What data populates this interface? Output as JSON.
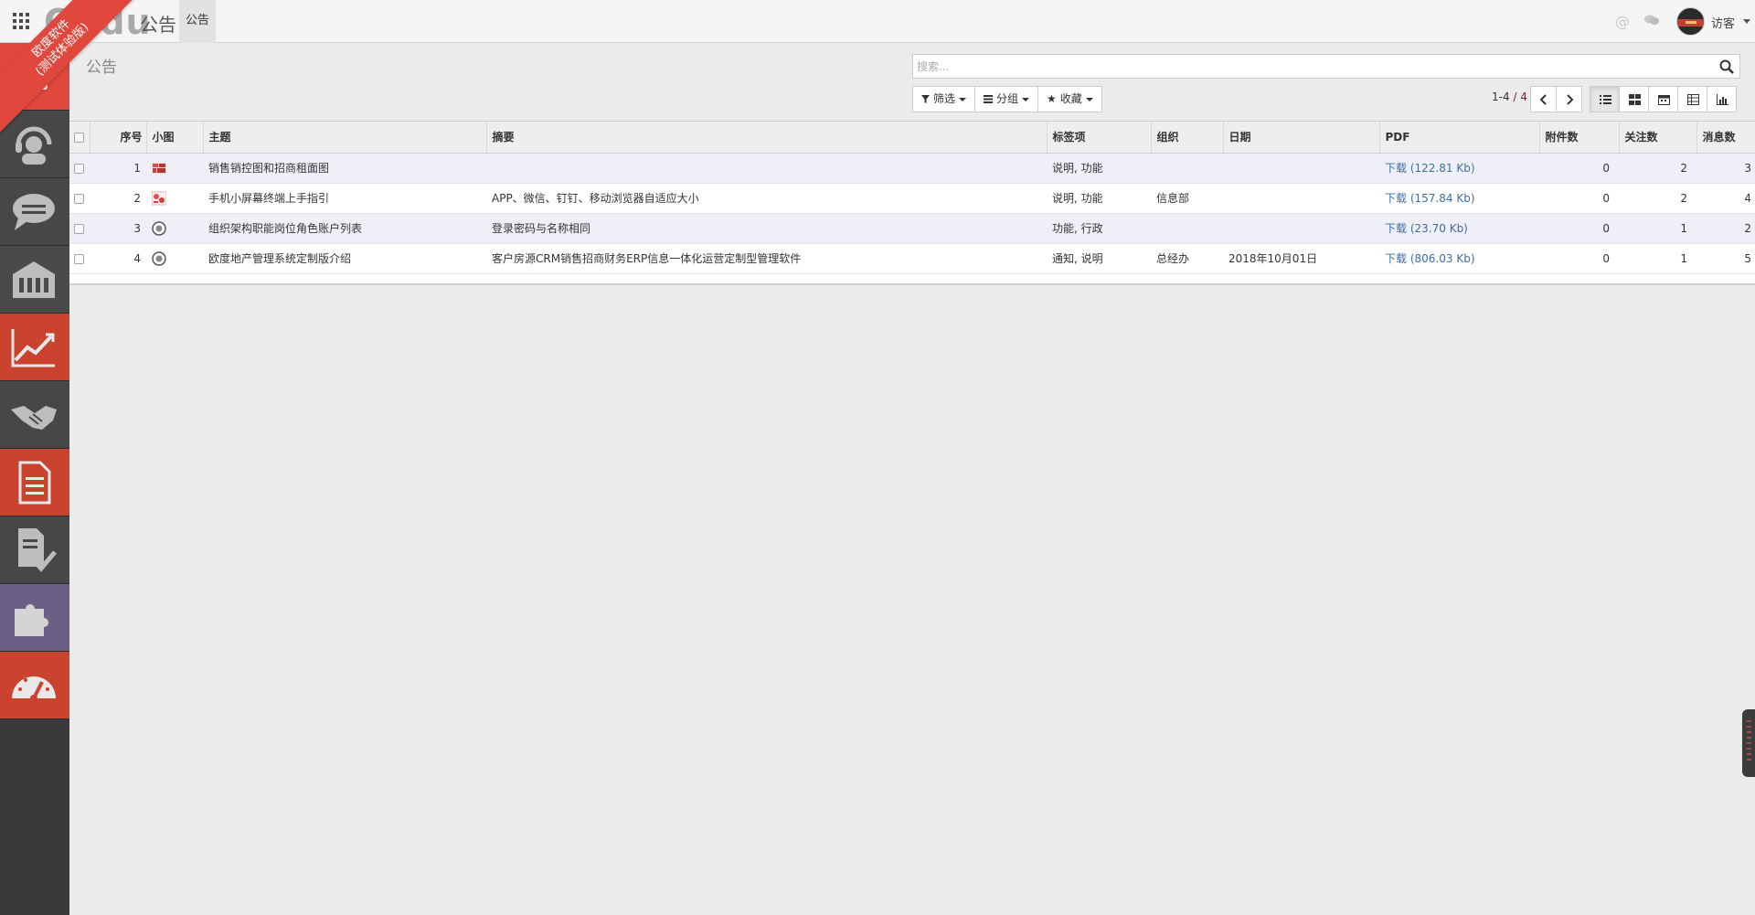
{
  "topbar": {
    "brand": "Oudu",
    "module_title": "公告",
    "menu_tab": "公告",
    "user_name": "访客"
  },
  "ribbon": {
    "line1": "欧度软件",
    "line2": "(测试体验版)"
  },
  "sidebar": {
    "items": [
      {
        "icon": "calendar-icon",
        "color": "#e0473d"
      },
      {
        "icon": "headset-icon",
        "color": "#474747"
      },
      {
        "icon": "chat-bubble-icon",
        "color": "#474747"
      },
      {
        "icon": "building-icon",
        "color": "#4a4a4a"
      },
      {
        "icon": "trend-chart-icon",
        "color": "#c9432f"
      },
      {
        "icon": "handshake-icon",
        "color": "#474747"
      },
      {
        "icon": "document-icon",
        "color": "#c9432f"
      },
      {
        "icon": "checklist-icon",
        "color": "#474747"
      },
      {
        "icon": "puzzle-icon",
        "color": "#6b5f86"
      },
      {
        "icon": "dashboard-icon",
        "color": "#c9432f"
      }
    ]
  },
  "control": {
    "page_title": "公告",
    "search_placeholder": "搜索...",
    "filter_label": "筛选",
    "group_label": "分组",
    "favorite_label": "收藏",
    "pager_range": "1-4",
    "pager_separator": " / ",
    "pager_total": "4"
  },
  "table": {
    "headers": {
      "seq": "序号",
      "thumb": "小图",
      "subject": "主题",
      "summary": "摘要",
      "tags": "标签项",
      "org": "组织",
      "date": "日期",
      "pdf": "PDF",
      "attachments": "附件数",
      "followers": "关注数",
      "messages": "消息数"
    },
    "rows": [
      {
        "seq": "1",
        "thumb": "chart-thumb-icon",
        "subject": "销售销控图和招商租面图",
        "summary": "",
        "tags": "说明, 功能",
        "org": "",
        "date": "",
        "pdf_link": "下载",
        "pdf_size": "(122.81 Kb)",
        "attachments": "0",
        "followers": "2",
        "messages": "3"
      },
      {
        "seq": "2",
        "thumb": "phone-thumb-icon",
        "subject": "手机小屏幕终端上手指引",
        "summary": "APP、微信、钉钉、移动浏览器自适应大小",
        "tags": "说明, 功能",
        "org": "信息部",
        "date": "",
        "pdf_link": "下载",
        "pdf_size": "(157.84 Kb)",
        "attachments": "0",
        "followers": "2",
        "messages": "4"
      },
      {
        "seq": "3",
        "thumb": "circle-thumb-icon",
        "subject": "组织架构职能岗位角色账户列表",
        "summary": "登录密码与名称相同",
        "tags": "功能, 行政",
        "org": "",
        "date": "",
        "pdf_link": "下载",
        "pdf_size": "(23.70 Kb)",
        "attachments": "0",
        "followers": "1",
        "messages": "2"
      },
      {
        "seq": "4",
        "thumb": "circle-thumb-icon",
        "subject": "欧度地产管理系统定制版介绍",
        "summary": "客户房源CRM销售招商财务ERP信息一体化运营定制型管理软件",
        "tags": "通知, 说明",
        "org": "总经办",
        "date": "2018年10月01日",
        "pdf_link": "下载",
        "pdf_size": "(806.03 Kb)",
        "attachments": "0",
        "followers": "1",
        "messages": "5"
      }
    ]
  }
}
